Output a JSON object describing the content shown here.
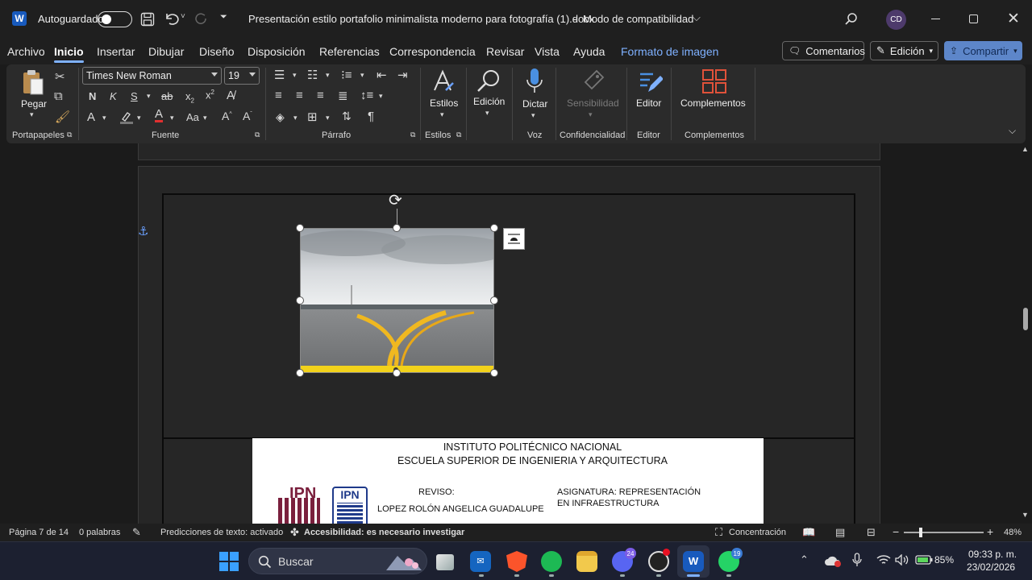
{
  "titlebar": {
    "autosave_label": "Autoguardado",
    "doc_title": "Presentación estilo portafolio minimalista moderno para fotografía (1).docx",
    "title_sep": "-",
    "compat_mode": "Modo de compatibilidad",
    "user_initials": "CD"
  },
  "menu": {
    "items": [
      "Archivo",
      "Inicio",
      "Insertar",
      "Dibujar",
      "Diseño",
      "Disposición",
      "Referencias",
      "Correspondencia",
      "Revisar",
      "Vista",
      "Ayuda"
    ],
    "context_tab": "Formato de imagen",
    "comments_label": "Comentarios",
    "edit_label": "Edición",
    "share_label": "Compartir"
  },
  "ribbon": {
    "clipboard": {
      "paste": "Pegar",
      "group": "Portapapeles"
    },
    "font": {
      "name": "Times New Roman",
      "size": "19",
      "group": "Fuente",
      "bold": "N",
      "italic": "K",
      "underline": "S",
      "strike": "ab",
      "case": "Aa"
    },
    "paragraph": {
      "group": "Párrafo"
    },
    "styles": {
      "label": "Estilos",
      "group": "Estilos"
    },
    "editing": {
      "label": "Edición"
    },
    "voice": {
      "label": "Dictar",
      "group": "Voz"
    },
    "sensitivity": {
      "label": "Sensibilidad",
      "group": "Confidencialidad"
    },
    "editor": {
      "label": "Editor",
      "group": "Editor"
    },
    "addins": {
      "label": "Complementos",
      "group": "Complementos"
    }
  },
  "document": {
    "institution": "INSTITUTO POLITÉCNICO NACIONAL",
    "school": "ESCUELA SUPERIOR DE INGENIERIA Y ARQUITECTURA",
    "reviewed_label": "REVISO:",
    "reviewer": "LOPEZ ROLÓN ANGELICA GUADALUPE",
    "subject_line1": "ASIGNATURA: REPRESENTACIÓN",
    "subject_line2": "EN INFRAESTRUCTURA",
    "logo1": "IPN",
    "logo2": "IPN"
  },
  "status": {
    "page": "Página 7 de 14",
    "words": "0 palabras",
    "predictions": "Predicciones de texto: activado",
    "accessibility": "Accesibilidad: es necesario investigar",
    "focus": "Concentración",
    "zoom": "48%"
  },
  "taskbar": {
    "search_placeholder": "Buscar",
    "discord_badge": "24",
    "whatsapp_badge": "19",
    "battery": "85%",
    "time": "09:33 p. m.",
    "date": "23/02/2026"
  },
  "colors": {
    "accent": "#7fb1ff",
    "ribbon_bg": "#2b2b2b",
    "taskbar_bg": "#1c2030",
    "runway_yellow": "#f2c21b",
    "ipn_maroon": "#7a1f3d",
    "ipn_blue": "#1f3a8a"
  }
}
